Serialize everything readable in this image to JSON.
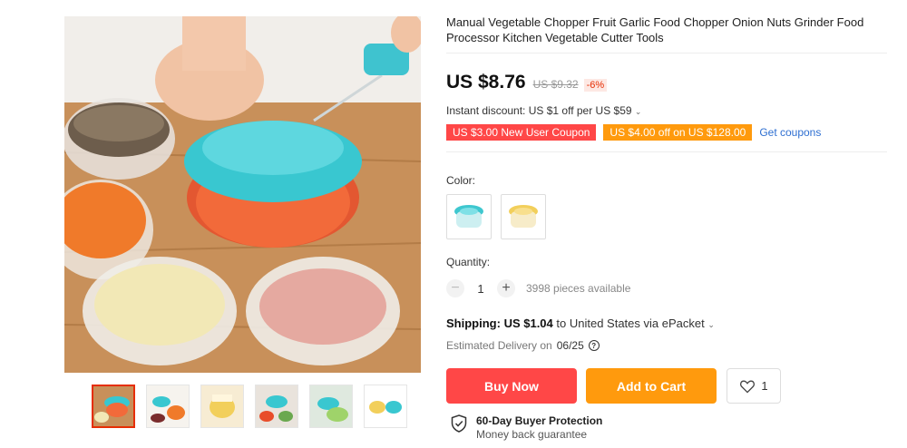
{
  "product": {
    "title": "Manual Vegetable Chopper Fruit Garlic Food Chopper Onion Nuts Grinder Food Processor Kitchen Vegetable Cutter Tools",
    "price": "US $8.76",
    "original_price": "US $9.32",
    "discount": "-6%"
  },
  "promotions": {
    "instant_discount": "Instant discount: US $1 off per US $59",
    "coupons": [
      {
        "label": "US $3.00 New User Coupon",
        "color": "#ff4747"
      },
      {
        "label": "US $4.00 off on US $128.00",
        "color": "#ff9a0d"
      }
    ],
    "get_coupons": "Get coupons"
  },
  "options": {
    "color_label": "Color:",
    "colors": [
      {
        "name": "teal",
        "hex": "#3ec7cf"
      },
      {
        "name": "yellow",
        "hex": "#f2cf5b"
      }
    ]
  },
  "quantity": {
    "label": "Quantity:",
    "value": "1",
    "available": "3998 pieces available"
  },
  "shipping": {
    "label": "Shipping:",
    "cost": "US $1.04",
    "destination": "to United States via ePacket",
    "delivery_prefix": "Estimated Delivery on",
    "delivery_date": "06/25"
  },
  "actions": {
    "buy_now": "Buy Now",
    "add_to_cart": "Add to Cart",
    "wishlist_count": "1"
  },
  "protection": {
    "title": "60-Day Buyer Protection",
    "subtitle": "Money back guarantee"
  },
  "gallery": {
    "thumbnail_count": 6,
    "active_index": 0
  },
  "colors": {
    "accent_red": "#ff4747",
    "accent_orange": "#ff9a0d",
    "link_blue": "#2e6fd1"
  }
}
